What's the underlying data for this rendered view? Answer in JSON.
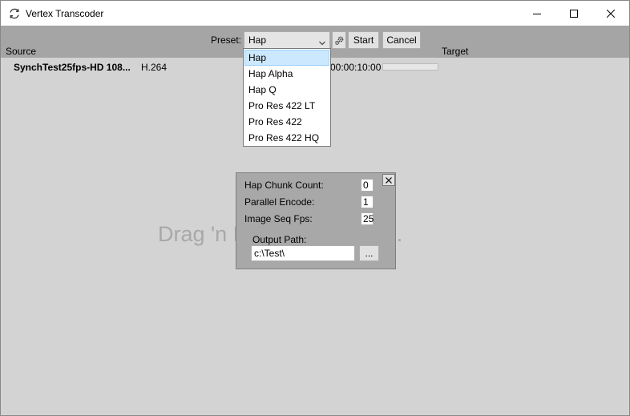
{
  "window": {
    "title": "Vertex Transcoder"
  },
  "toolbar": {
    "preset_label": "Preset:",
    "preset_value": "Hap",
    "start_label": "Start",
    "cancel_label": "Cancel"
  },
  "columns": {
    "source": "Source",
    "target": "Target"
  },
  "job": {
    "name": "SynchTest25fps-HD 108...",
    "codec": "H.264",
    "duration": "00:00:10:00",
    "progress": 0
  },
  "drop_hint": "Drag 'n Drop Files Here...",
  "preset_options": [
    "Hap",
    "Hap Alpha",
    "Hap Q",
    "Pro Res 422 LT",
    "Pro Res 422",
    "Pro Res 422 HQ"
  ],
  "preset_selected_index": 0,
  "settings": {
    "chunk_count_label": "Hap Chunk Count:",
    "chunk_count_value": "0",
    "parallel_label": "Parallel Encode:",
    "parallel_value": "1",
    "fps_label": "Image Seq Fps:",
    "fps_value": "25",
    "output_label": "Output Path:",
    "output_value": "c:\\Test\\",
    "browse_label": "..."
  }
}
